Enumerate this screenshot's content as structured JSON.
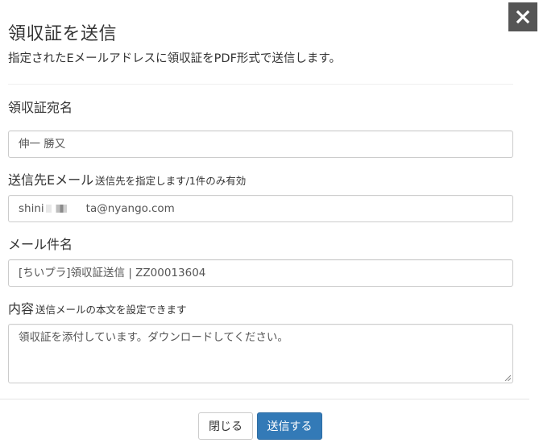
{
  "dialog": {
    "title": "領収証を送信",
    "subtitle": "指定されたEメールアドレスに領収証をPDF形式で送信します。"
  },
  "form": {
    "recipient_name": {
      "label": "領収証宛名",
      "value": "伸一 勝又"
    },
    "email": {
      "label": "送信先Eメール",
      "hint": "送信先を指定します/1件のみ有効",
      "value_prefix": "shini",
      "value_suffix": "ta@nyango.com"
    },
    "subject": {
      "label": "メール件名",
      "value": "[ちいプラ]領収証送信 | ZZ00013604"
    },
    "body": {
      "label": "内容",
      "hint": "送信メールの本文を設定できます",
      "value": "領収証を添付しています。ダウンロードしてください。"
    }
  },
  "footer": {
    "close_label": "閉じる",
    "send_label": "送信する"
  },
  "icons": {
    "close": "close-icon",
    "resize": "resize-grip-icon"
  },
  "colors": {
    "primary": "#337ab7",
    "close_bg": "#555555"
  }
}
